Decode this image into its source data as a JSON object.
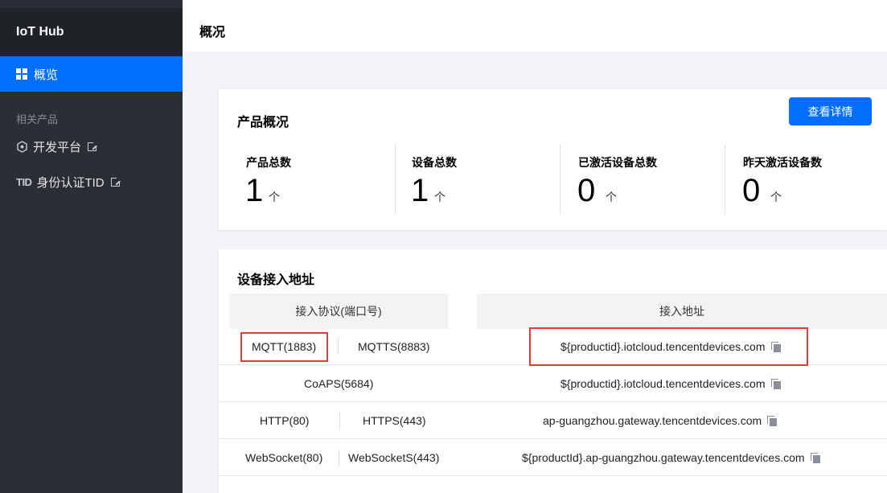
{
  "sidebar": {
    "brand": "IoT Hub",
    "active_item": {
      "label": "概览"
    },
    "section_title": "相关产品",
    "links": [
      {
        "label": "开发平台",
        "icon": "dev-platform-icon"
      },
      {
        "label": "身份认证TID",
        "icon_text": "TID"
      }
    ]
  },
  "header": {
    "title": "概况"
  },
  "overview": {
    "title": "产品概况",
    "detail_button": "查看详情",
    "stats": [
      {
        "label": "产品总数",
        "value": "1",
        "unit": "个"
      },
      {
        "label": "设备总数",
        "value": "1",
        "unit": "个"
      },
      {
        "label": "已激活设备总数",
        "value": "0",
        "unit": "个"
      },
      {
        "label": "昨天激活设备数",
        "value": "0",
        "unit": "个"
      }
    ]
  },
  "access": {
    "title": "设备接入地址",
    "columns": [
      "接入协议(端口号)",
      "接入地址"
    ],
    "rows": [
      {
        "protocols": [
          "MQTT(1883)",
          "MQTTS(8883)"
        ],
        "address": "${productid}.iotcloud.tencentdevices.com"
      },
      {
        "protocols": [
          "CoAPS(5684)"
        ],
        "address": "${productid}.iotcloud.tencentdevices.com"
      },
      {
        "protocols": [
          "HTTP(80)",
          "HTTPS(443)"
        ],
        "address": "ap-guangzhou.gateway.tencentdevices.com"
      },
      {
        "protocols": [
          "WebSocket(80)",
          "WebSocketS(443)"
        ],
        "address": "${productId}.ap-guangzhou.gateway.tencentdevices.com"
      }
    ]
  },
  "colors": {
    "accent": "#006eff",
    "sidebar_bg": "#2b2e35",
    "highlight": "#e03b3b"
  }
}
